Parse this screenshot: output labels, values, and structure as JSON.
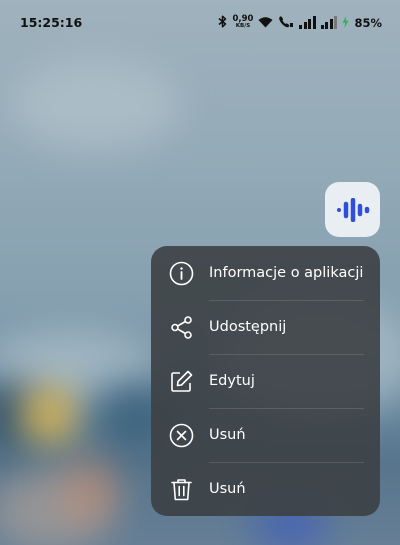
{
  "status_bar": {
    "time": "15:25:16",
    "net_speed": "0,90",
    "net_unit": "KB/S",
    "battery": "85%",
    "icons": [
      "bluetooth-icon",
      "wifi-icon",
      "wifi-call-icon",
      "signal-icon",
      "signal-icon",
      "battery-charging-icon"
    ]
  },
  "app_icon": {
    "icon": "voice-wave-icon",
    "color": "#2f50d6"
  },
  "menu": {
    "items": [
      {
        "icon": "info-icon",
        "label": "Informacje o aplikacji"
      },
      {
        "icon": "share-icon",
        "label": "Udostępnij"
      },
      {
        "icon": "edit-icon",
        "label": "Edytuj"
      },
      {
        "icon": "close-circle-icon",
        "label": "Usuń"
      },
      {
        "icon": "trash-icon",
        "label": "Usuń"
      }
    ]
  }
}
